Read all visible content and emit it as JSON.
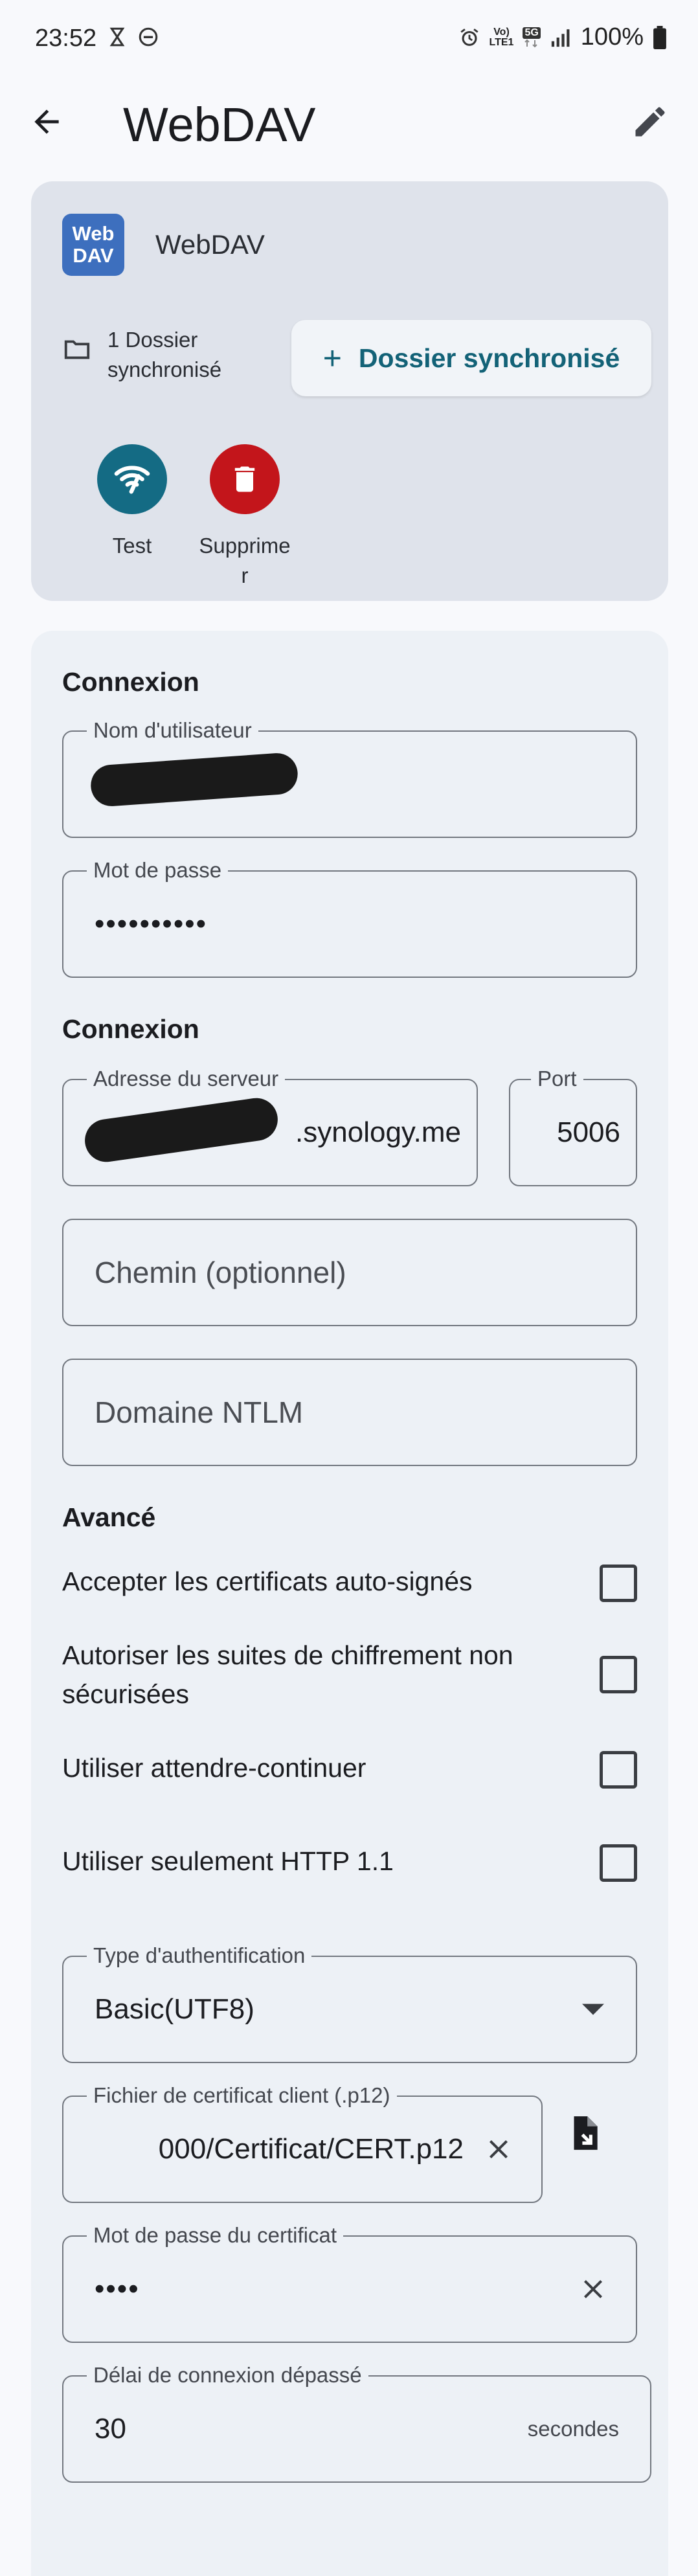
{
  "status_bar": {
    "time": "23:52",
    "battery": "100%",
    "network_top": "Vo)",
    "network_bottom": "LTE1",
    "net_type": "5G"
  },
  "app_bar": {
    "title": "WebDAV"
  },
  "account": {
    "logo_line1": "Web",
    "logo_line2": "DAV",
    "name": "WebDAV",
    "folders_line1": "1 Dossier",
    "folders_line2": "synchronisé",
    "add_folder_label": "Dossier synchronisé",
    "actions": {
      "test_label": "Test",
      "delete_label_line1": "Supprime",
      "delete_label_line2": "r"
    }
  },
  "settings": {
    "section_login": "Connexion",
    "username": {
      "label": "Nom d'utilisateur",
      "value": "c"
    },
    "password": {
      "label": "Mot de passe",
      "value": "••••••••••"
    },
    "section_server": "Connexion",
    "server": {
      "label": "Adresse du serveur",
      "value": ".synology.me"
    },
    "port": {
      "label": "Port",
      "value": "5006"
    },
    "path": {
      "placeholder": "Chemin (optionnel)"
    },
    "ntlm": {
      "placeholder": "Domaine NTLM"
    },
    "section_advanced": "Avancé",
    "checks": [
      {
        "label": "Accepter les certificats auto-signés",
        "checked": false
      },
      {
        "label": "Autoriser les suites de chiffrement non sécurisées",
        "checked": false
      },
      {
        "label": "Utiliser attendre-continuer",
        "checked": false
      },
      {
        "label": "Utiliser seulement HTTP 1.1",
        "checked": false
      }
    ],
    "auth_type": {
      "label": "Type d'authentification",
      "value": "Basic(UTF8)"
    },
    "client_cert": {
      "label": "Fichier de certificat client (.p12)",
      "value": "000/Certificat/CERT.p12"
    },
    "cert_password": {
      "label": "Mot de passe du certificat",
      "value": "••••"
    },
    "timeout": {
      "label": "Délai de connexion dépassé",
      "value": "30",
      "suffix": "secondes"
    }
  },
  "colors": {
    "accent": "#136277",
    "test_button": "#146b84",
    "delete_button": "#c3151b",
    "logo": "#3d6fbe"
  },
  "icons": {
    "back": "arrow-left-icon",
    "edit": "pencil-icon",
    "folder": "folder-icon",
    "test": "wifi-test-icon",
    "delete": "trash-icon",
    "dropdown": "caret-down-icon",
    "clear": "close-icon",
    "file_pick": "file-import-icon"
  }
}
